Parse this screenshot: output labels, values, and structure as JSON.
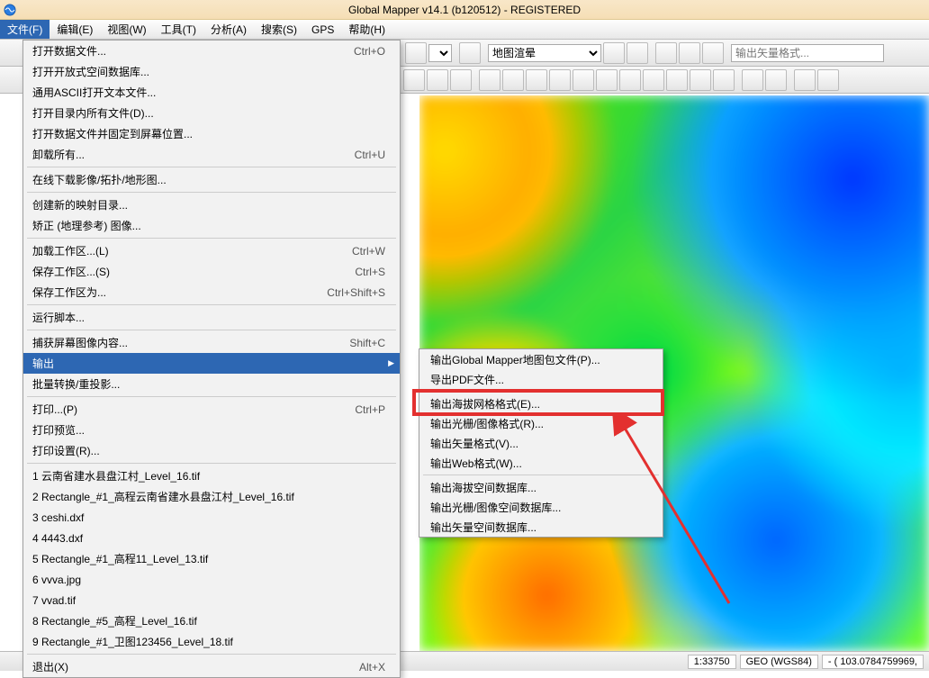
{
  "title": "Global Mapper v14.1 (b120512) - REGISTERED",
  "menubar": {
    "items": [
      {
        "label": "文件(F)",
        "active": true
      },
      {
        "label": "编辑(E)"
      },
      {
        "label": "视图(W)"
      },
      {
        "label": "工具(T)"
      },
      {
        "label": "分析(A)"
      },
      {
        "label": "搜索(S)"
      },
      {
        "label": "GPS"
      },
      {
        "label": "帮助(H)"
      }
    ]
  },
  "toolbar2": {
    "select_value": "地图渲晕",
    "search_placeholder": "输出矢量格式..."
  },
  "file_menu": {
    "items": [
      {
        "label": "打开数据文件...",
        "shortcut": "Ctrl+O"
      },
      {
        "label": "打开开放式空间数据库..."
      },
      {
        "label": "通用ASCII打开文本文件..."
      },
      {
        "label": "打开目录内所有文件(D)..."
      },
      {
        "label": "打开数据文件并固定到屏幕位置..."
      },
      {
        "label": "卸载所有...",
        "shortcut": "Ctrl+U"
      },
      {
        "sep": true
      },
      {
        "label": "在线下载影像/拓扑/地形图..."
      },
      {
        "sep": true
      },
      {
        "label": "创建新的映射目录..."
      },
      {
        "label": "矫正 (地理参考) 图像..."
      },
      {
        "sep": true
      },
      {
        "label": "加载工作区...(L)",
        "shortcut": "Ctrl+W"
      },
      {
        "label": "保存工作区...(S)",
        "shortcut": "Ctrl+S"
      },
      {
        "label": "保存工作区为...",
        "shortcut": "Ctrl+Shift+S"
      },
      {
        "sep": true
      },
      {
        "label": "运行脚本..."
      },
      {
        "sep": true
      },
      {
        "label": "捕获屏幕图像内容...",
        "shortcut": "Shift+C"
      },
      {
        "label": "输出",
        "highlight": true,
        "arrow": true
      },
      {
        "label": "批量转换/重投影..."
      },
      {
        "sep": true
      },
      {
        "label": "打印...(P)",
        "shortcut": "Ctrl+P"
      },
      {
        "label": "打印预览..."
      },
      {
        "label": "打印设置(R)..."
      },
      {
        "sep": true
      },
      {
        "label": "1 云南省建水县盘江村_Level_16.tif"
      },
      {
        "label": "2 Rectangle_#1_高程云南省建水县盘江村_Level_16.tif"
      },
      {
        "label": "3 ceshi.dxf"
      },
      {
        "label": "4 4443.dxf"
      },
      {
        "label": "5 Rectangle_#1_高程11_Level_13.tif"
      },
      {
        "label": "6 vvva.jpg"
      },
      {
        "label": "7 vvad.tif"
      },
      {
        "label": "8 Rectangle_#5_高程_Level_16.tif"
      },
      {
        "label": "9 Rectangle_#1_卫图123456_Level_18.tif"
      },
      {
        "sep": true
      },
      {
        "label": "退出(X)",
        "shortcut": "Alt+X"
      }
    ]
  },
  "export_submenu": {
    "items": [
      {
        "label": "输出Global Mapper地图包文件(P)..."
      },
      {
        "label": "导出PDF文件..."
      },
      {
        "sep": true
      },
      {
        "label": "输出海拔网格格式(E)...",
        "boxed": true
      },
      {
        "label": "输出光栅/图像格式(R)..."
      },
      {
        "label": "输出矢量格式(V)..."
      },
      {
        "label": "输出Web格式(W)..."
      },
      {
        "sep": true
      },
      {
        "label": "输出海拔空间数据库..."
      },
      {
        "label": "输出光栅/图像空间数据库..."
      },
      {
        "label": "输出矢量空间数据库..."
      }
    ]
  },
  "statusbar": {
    "scale": "1:33750",
    "proj": "GEO (WGS84)",
    "coords": "- ( 103.0784759969,"
  }
}
